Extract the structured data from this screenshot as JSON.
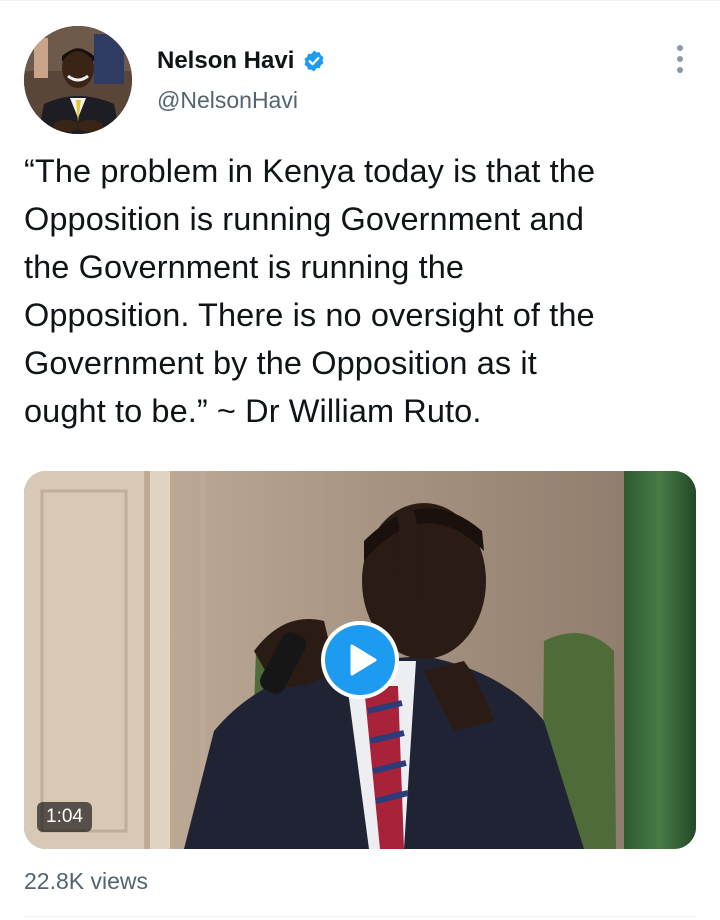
{
  "author": {
    "display_name": "Nelson Havi",
    "handle": "@NelsonHavi",
    "verified": true,
    "avatar_icon": "profile-photo"
  },
  "tweet": {
    "text": "“The problem in Kenya today is that the\nOpposition is running Government and\nthe Government is running the\nOpposition. There is no oversight of the\nGovernment by the Opposition as it\nought to be.” ~ Dr William Ruto."
  },
  "media": {
    "type": "video",
    "duration": "1:04",
    "play_icon": "play-icon"
  },
  "stats": {
    "views": "22.8K views"
  },
  "menu": {
    "icon": "more-options-icon"
  },
  "colors": {
    "accent": "#1d9bf0",
    "secondary_text": "#536471",
    "primary_text": "#0f1419"
  }
}
